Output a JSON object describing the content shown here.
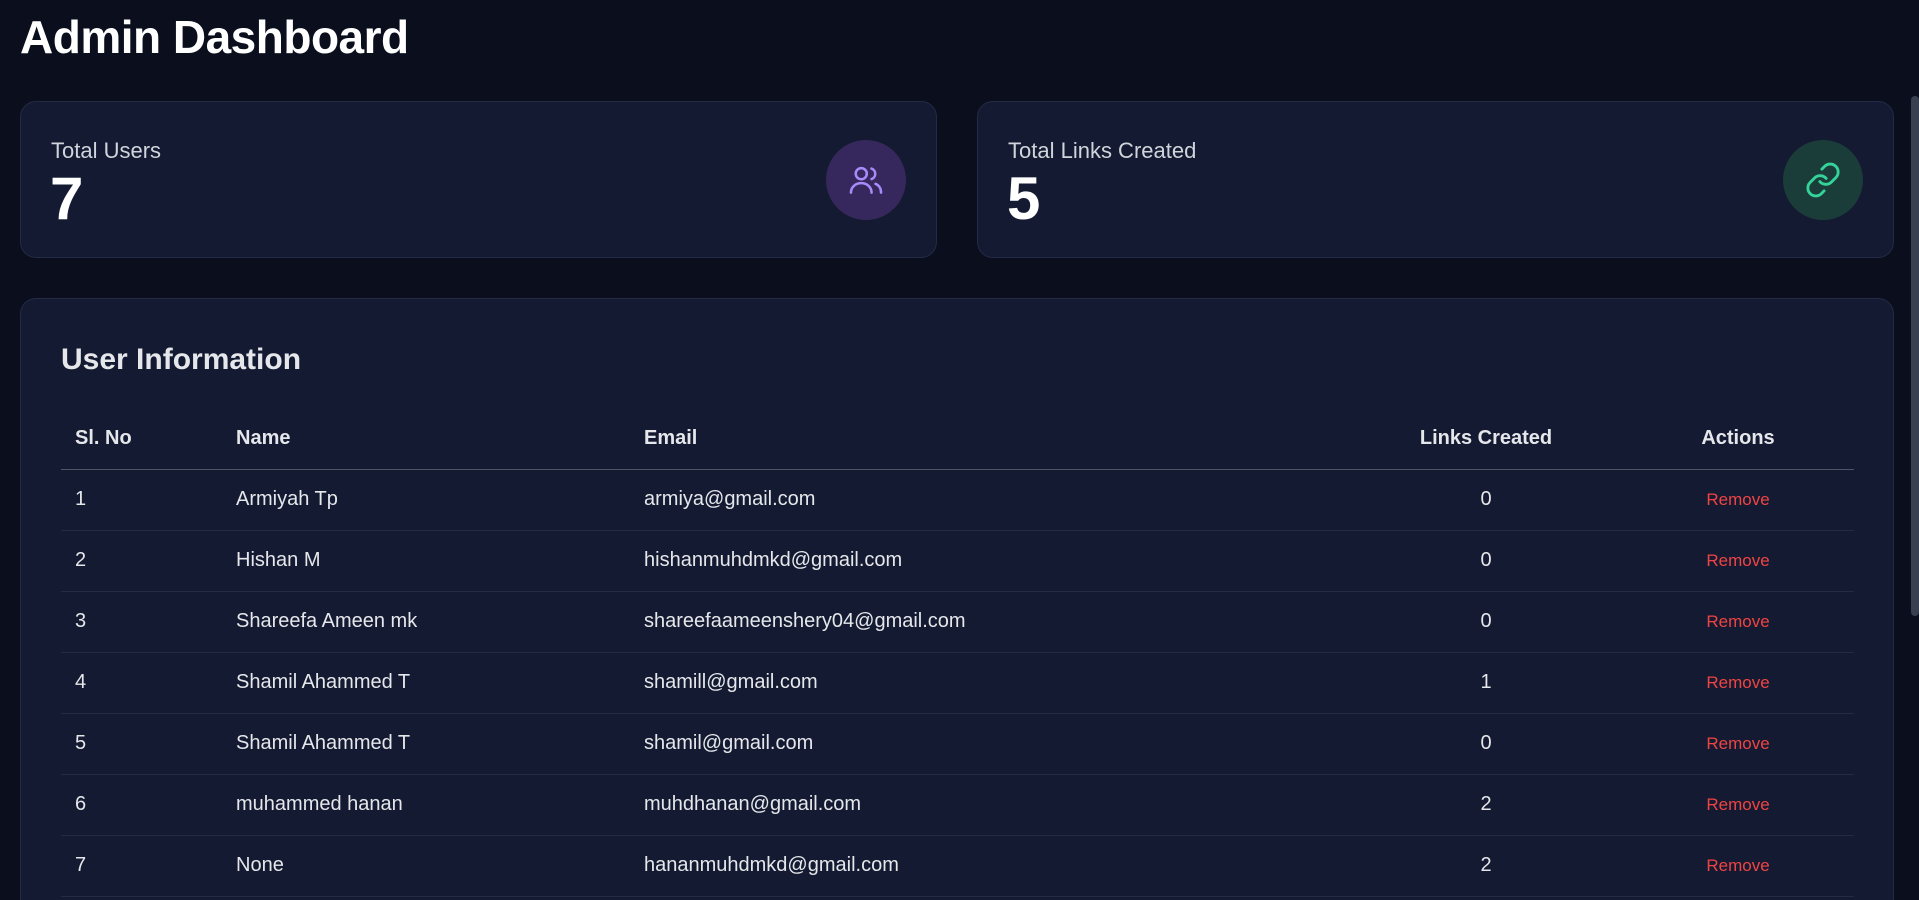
{
  "page": {
    "title": "Admin Dashboard"
  },
  "stats": {
    "users": {
      "label": "Total Users",
      "value": "7",
      "icon": "users-icon",
      "color": "#a78bfa"
    },
    "links": {
      "label": "Total Links Created",
      "value": "5",
      "icon": "link-icon",
      "color": "#34d399"
    }
  },
  "user_info": {
    "title": "User Information",
    "columns": [
      "Sl. No",
      "Name",
      "Email",
      "Links Created",
      "Actions"
    ],
    "rows": [
      {
        "sl": "1",
        "name": "Armiyah Tp",
        "email": "armiya@gmail.com",
        "links": "0",
        "action": "Remove"
      },
      {
        "sl": "2",
        "name": "Hishan M",
        "email": "hishanmuhdmkd@gmail.com",
        "links": "0",
        "action": "Remove"
      },
      {
        "sl": "3",
        "name": "Shareefa Ameen mk",
        "email": "shareefaameenshery04@gmail.com",
        "links": "0",
        "action": "Remove"
      },
      {
        "sl": "4",
        "name": "Shamil Ahammed T",
        "email": "shamill@gmail.com",
        "links": "1",
        "action": "Remove"
      },
      {
        "sl": "5",
        "name": "Shamil Ahammed T",
        "email": "shamil@gmail.com",
        "links": "0",
        "action": "Remove"
      },
      {
        "sl": "6",
        "name": "muhammed hanan",
        "email": "muhdhanan@gmail.com",
        "links": "2",
        "action": "Remove"
      },
      {
        "sl": "7",
        "name": "None",
        "email": "hananmuhdmkd@gmail.com",
        "links": "2",
        "action": "Remove"
      }
    ]
  }
}
